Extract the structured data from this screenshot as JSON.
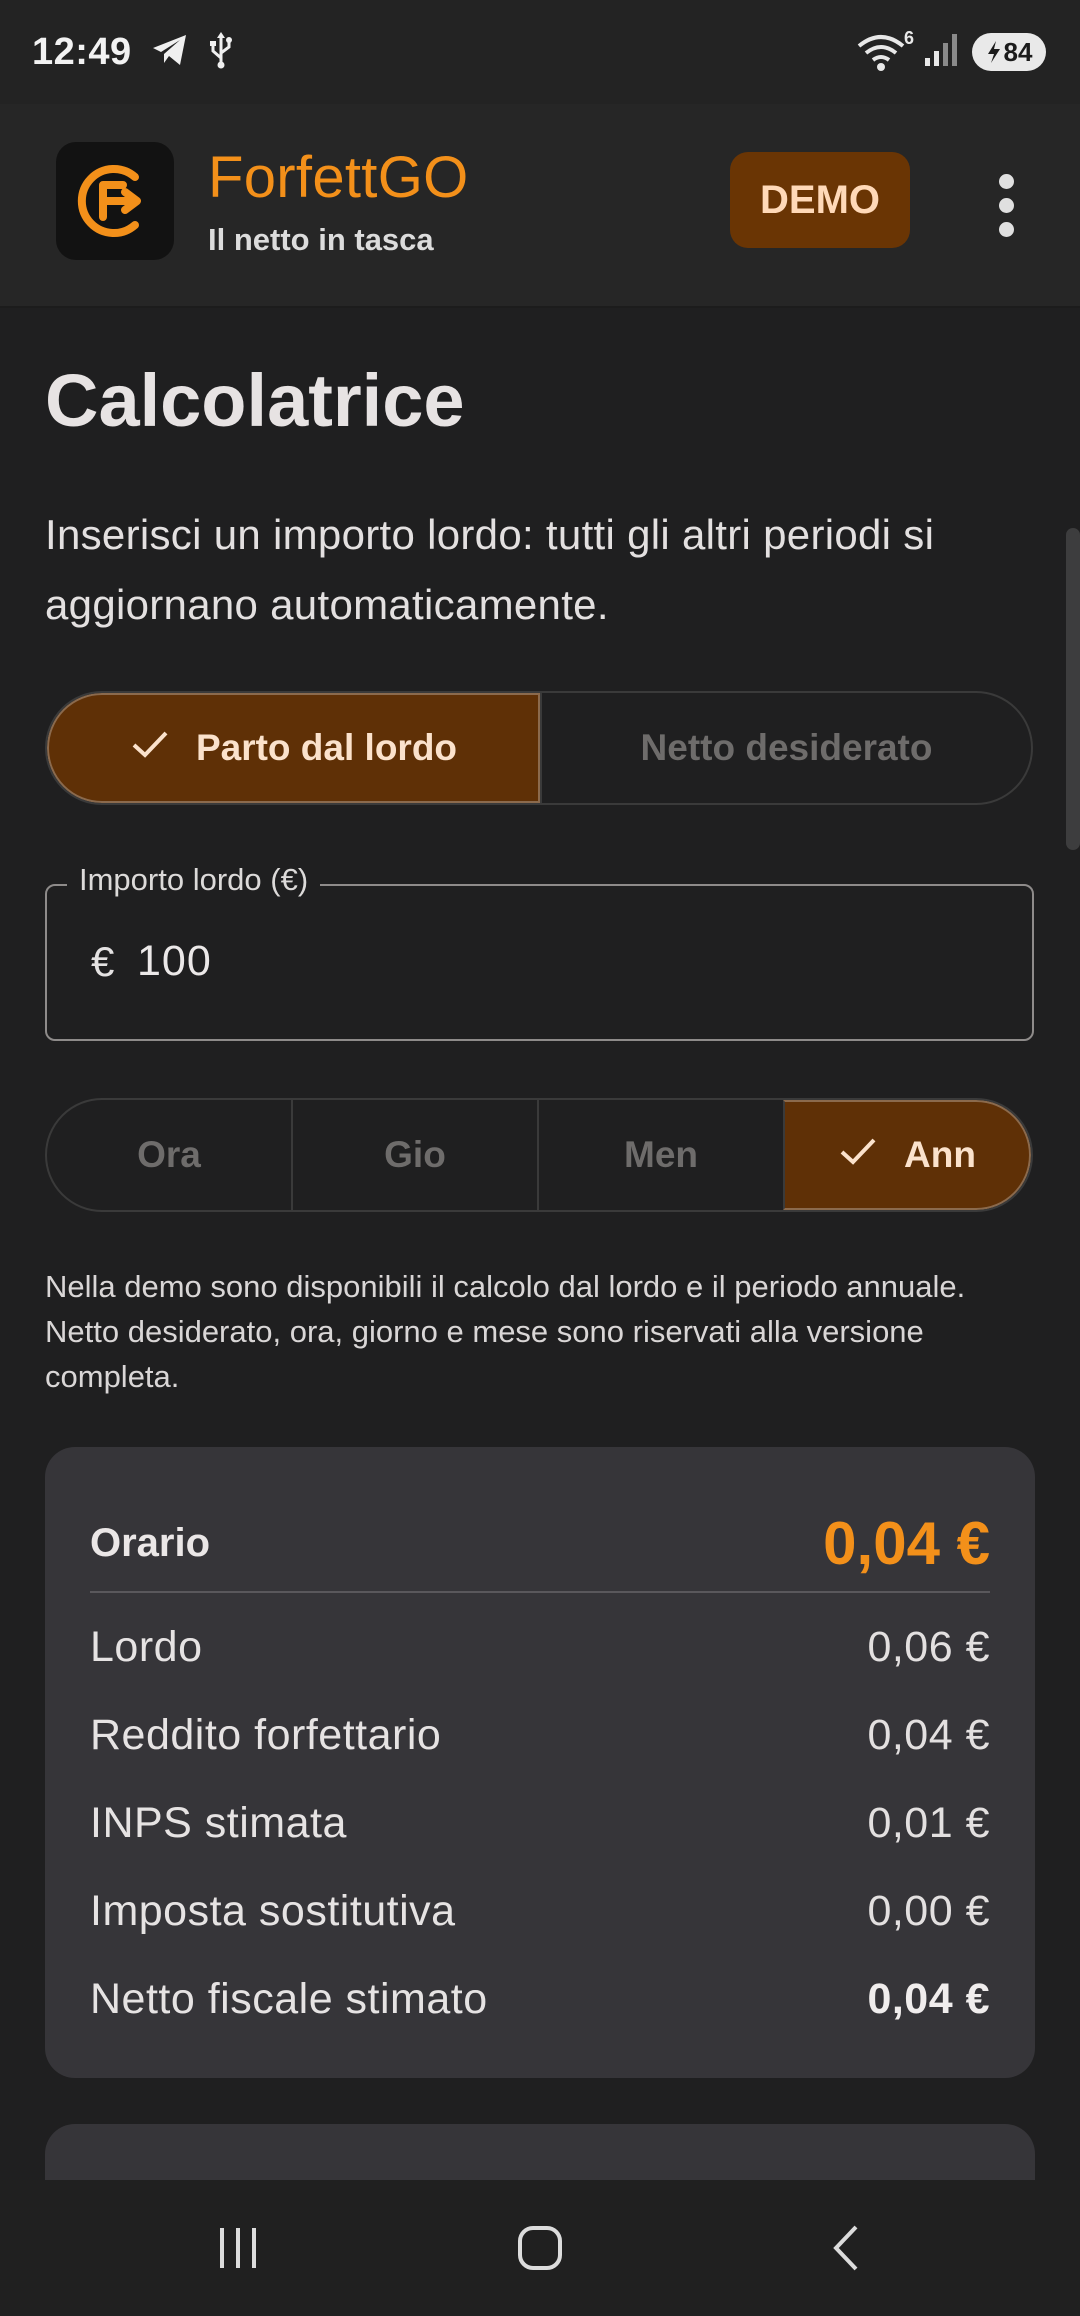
{
  "status_bar": {
    "time": "12:49",
    "wifi_badge": "6",
    "battery": "84"
  },
  "app_bar": {
    "title": "ForfettGO",
    "subtitle": "Il netto in tasca",
    "demo_badge": "DEMO"
  },
  "calculator": {
    "title": "Calcolatrice",
    "intro": "Inserisci un importo lordo: tutti gli altri periodi si aggiornano automaticamente.",
    "mode_options": [
      {
        "label": "Parto dal lordo",
        "selected": true
      },
      {
        "label": "Netto desiderato",
        "selected": false
      }
    ],
    "amount_field": {
      "label": "Importo lordo (€)",
      "prefix": "€",
      "value": "100"
    },
    "period_options": [
      {
        "label": "Ora",
        "selected": false
      },
      {
        "label": "Gio",
        "selected": false
      },
      {
        "label": "Men",
        "selected": false
      },
      {
        "label": "Ann",
        "selected": true
      }
    ],
    "demo_note": "Nella demo sono disponibili il calcolo dal lordo e il periodo annuale. Netto desiderato, ora, giorno e mese sono riservati alla versione completa."
  },
  "result_card": {
    "heading": "Orario",
    "heading_value": "0,04 €",
    "rows": [
      {
        "label": "Lordo",
        "value": "0,06 €"
      },
      {
        "label": "Reddito forfettario",
        "value": "0,04 €"
      },
      {
        "label": "INPS stimata",
        "value": "0,01 €"
      },
      {
        "label": "Imposta sostitutiva",
        "value": "0,00 €"
      },
      {
        "label": "Netto fiscale stimato",
        "value": "0,04 €"
      }
    ]
  },
  "colors": {
    "accent": "#f3901a",
    "selected_segment": "#5f3006",
    "card": "#363539",
    "background": "#1f1f20"
  },
  "icons": [
    "telegram-icon",
    "usb-icon",
    "wifi-icon",
    "signal-icon",
    "battery-icon",
    "app-logo-icon",
    "more-vert-icon",
    "check-icon",
    "recents-icon",
    "home-icon",
    "back-icon"
  ]
}
